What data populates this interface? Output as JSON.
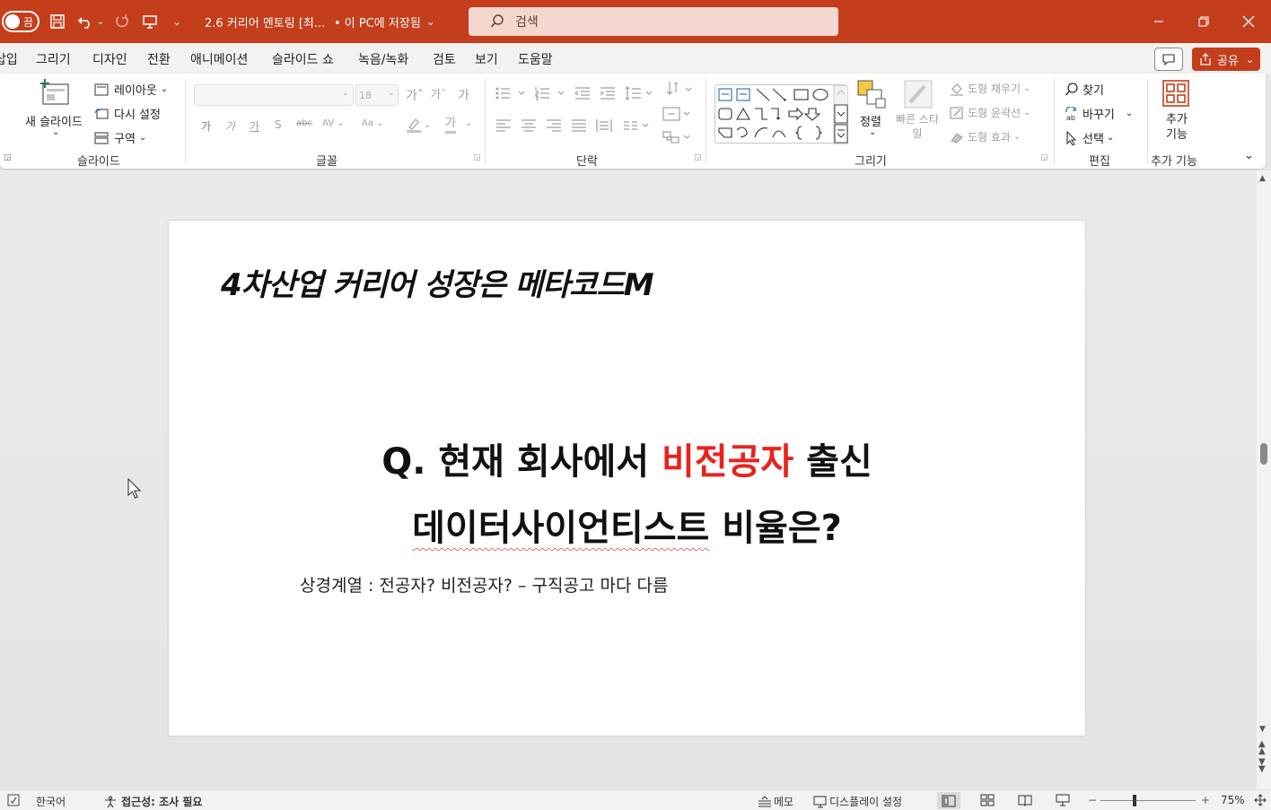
{
  "titlebar": {
    "autosave_label": "끔",
    "doc_title": "2.6 커리어 멘토링 [최...",
    "save_status": "• 이 PC에 저장됨",
    "search_placeholder": "검색",
    "accent": "#c43e1c"
  },
  "tabs": [
    "삽입",
    "그리기",
    "디자인",
    "전환",
    "애니메이션",
    "슬라이드 쇼",
    "녹음/녹화",
    "검토",
    "보기",
    "도움말"
  ],
  "share_label": "공유",
  "ribbon": {
    "slides": {
      "group_label": "슬라이드",
      "new_slide": "새 슬라이드",
      "layout": "레이아웃",
      "reset": "다시 설정",
      "section": "구역"
    },
    "font": {
      "group_label": "글꼴",
      "size": "18",
      "bold": "가",
      "italic": "가",
      "underline": "가",
      "strike": "S",
      "clear_label": "가",
      "font_color": "가"
    },
    "paragraph": {
      "group_label": "단락"
    },
    "drawing": {
      "group_label": "그리기",
      "arrange": "정렬",
      "quick_styles": "빠른 스타일",
      "shape_fill": "도형 채우기",
      "shape_outline": "도형 윤곽선",
      "shape_effects": "도형 효과"
    },
    "editing": {
      "group_label": "편집",
      "find": "찾기",
      "replace": "바꾸기",
      "select": "선택"
    },
    "addins": {
      "group_label": "추가 기능",
      "button": "추가 기능"
    }
  },
  "slide": {
    "heading": "4차산업 커리어 성장은 메타코드M",
    "question_line1_pre": "Q. 현재 회사에서 ",
    "question_line1_red": "비전공자",
    "question_line1_post": " 출신",
    "question_line2_underlined": "데이터사이언티스트",
    "question_line2_rest": " 비율은?",
    "note": "상경계열 : 전공자? 비전공자? – 구직공고 마다 다름",
    "red_color": "#e8231d"
  },
  "statusbar": {
    "language": "한국어",
    "accessibility": "접근성: 조사 필요",
    "notes": "메모",
    "display_settings": "디스플레이 설정",
    "zoom": "75%"
  }
}
